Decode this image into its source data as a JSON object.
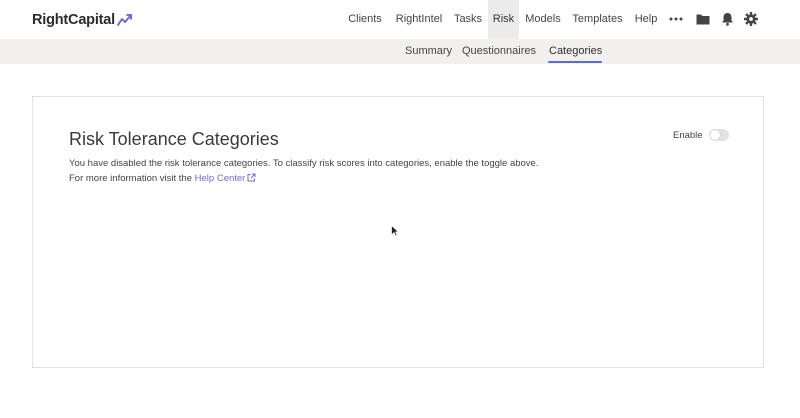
{
  "brand": {
    "name": "RightCapital",
    "accent": "#5b6bd6"
  },
  "nav": {
    "items": [
      {
        "label": "Clients"
      },
      {
        "label": "RightIntel"
      },
      {
        "label": "Tasks"
      },
      {
        "label": "Risk",
        "active": true
      },
      {
        "label": "Models"
      },
      {
        "label": "Templates"
      },
      {
        "label": "Help"
      }
    ],
    "icons": [
      "more-icon",
      "folder-icon",
      "bell-icon",
      "gear-icon"
    ]
  },
  "subnav": {
    "items": [
      {
        "label": "Summary"
      },
      {
        "label": "Questionnaires"
      },
      {
        "label": "Categories",
        "active": true
      }
    ]
  },
  "card": {
    "title": "Risk Tolerance Categories",
    "line1": "You have disabled the risk tolerance categories. To classify risk scores into categories, enable the toggle above.",
    "line2_prefix": "For more information visit the",
    "help_link": "Help Center",
    "toggle_label": "Enable",
    "toggle_on": false
  }
}
